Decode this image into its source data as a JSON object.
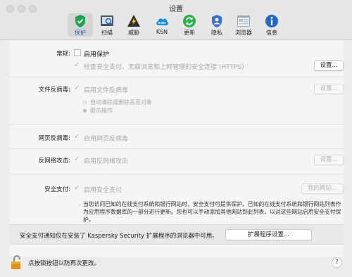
{
  "window": {
    "title": "设置"
  },
  "toolbar": {
    "items": [
      {
        "label": "保护",
        "icon": "shield-check-icon",
        "active": true
      },
      {
        "label": "扫描",
        "icon": "scan-icon",
        "active": false
      },
      {
        "label": "威胁",
        "icon": "threat-icon",
        "active": false
      },
      {
        "label": "KSN",
        "icon": "ksn-cloud-icon",
        "active": false
      },
      {
        "label": "更新",
        "icon": "update-icon",
        "active": false
      },
      {
        "label": "隐私",
        "icon": "privacy-icon",
        "active": false
      },
      {
        "label": "浏览器",
        "icon": "browser-icon",
        "active": false
      },
      {
        "label": "信息",
        "icon": "info-icon",
        "active": false
      }
    ]
  },
  "general": {
    "label": "常规:",
    "enable_protection": "启用保护",
    "check_secure": "检查安全支付、无痕浏览和上网管理的安全连接 (HTTPS)",
    "settings_button": "设置..."
  },
  "file_av": {
    "label": "文件反病毒:",
    "enable": "启用文件反病毒",
    "settings_button": "设置...",
    "auto_clean": "自动清除或删除恶意对象",
    "prompt": "提示操作"
  },
  "web_av": {
    "label": "网页反病毒:",
    "enable": "启用网页反病毒"
  },
  "network_attack": {
    "label": "反网络攻击:",
    "enable": "启用反网络攻击",
    "settings_button": "设置..."
  },
  "safe_money": {
    "label": "安全支付:",
    "enable": "启用安全支付",
    "my_sites_button": "我的网站...",
    "description": "当您访问已知的在线支付系统和银行网站时，安全支付可提供保护。已知的在线支付系统和银行网站列表作为应用程序数据库的一部分进行更新。您也可以手动添加其他网站到此列表，以对这些网站启用安全支付保护。"
  },
  "notice": {
    "text": "安全支付通知仅在安装了 Kaspersky Security 扩展程序的浏览器中可用。",
    "button": "扩展程序设置..."
  },
  "footer": {
    "lock_text": "点按锁按钮以防再次更改。",
    "help": "?"
  },
  "colors": {
    "accent": "#1560d4",
    "shield": "#20a34e",
    "ksn": "#1e8fe0",
    "update": "#2bb24c",
    "info": "#2368c9"
  }
}
